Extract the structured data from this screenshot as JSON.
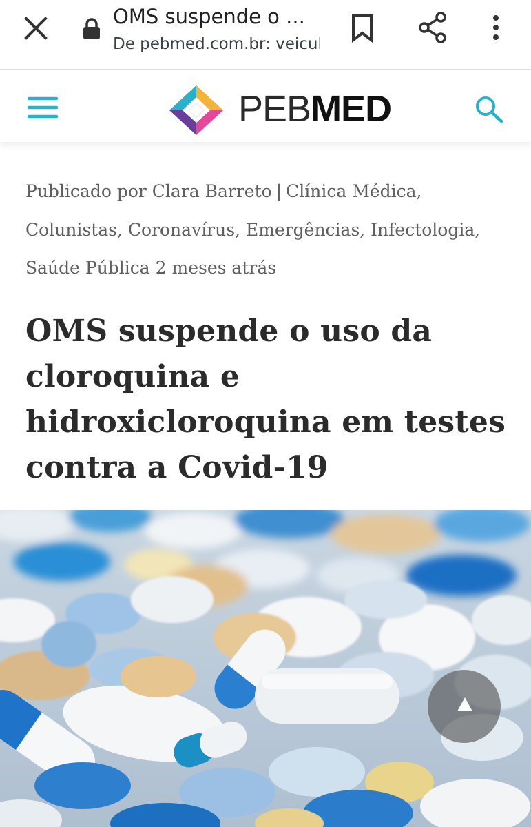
{
  "browser": {
    "title": "OMS suspende o ...",
    "url": "De pebmed.com.br: veicul",
    "icons": [
      "close-icon",
      "lock-icon",
      "bookmark-icon",
      "share-icon",
      "more-vert-icon"
    ]
  },
  "site": {
    "logo_light": "PEB",
    "logo_bold": "MED",
    "accent_color": "#2bb0c9",
    "icons": [
      "menu-icon",
      "search-icon"
    ]
  },
  "article": {
    "meta": {
      "prefix": "Publicado por",
      "author": "Clara Barreto",
      "separator": "|",
      "categories": "Clínica Médica, Colunistas, Coronavírus, Emergências, Infectologia, Saúde Pública",
      "time": "2 meses atrás"
    },
    "headline": "OMS suspende o uso da cloroquina e hidroxicloroquina em testes contra a Covid-19"
  },
  "scroll_top": {
    "icon": "arrow-up-icon"
  }
}
